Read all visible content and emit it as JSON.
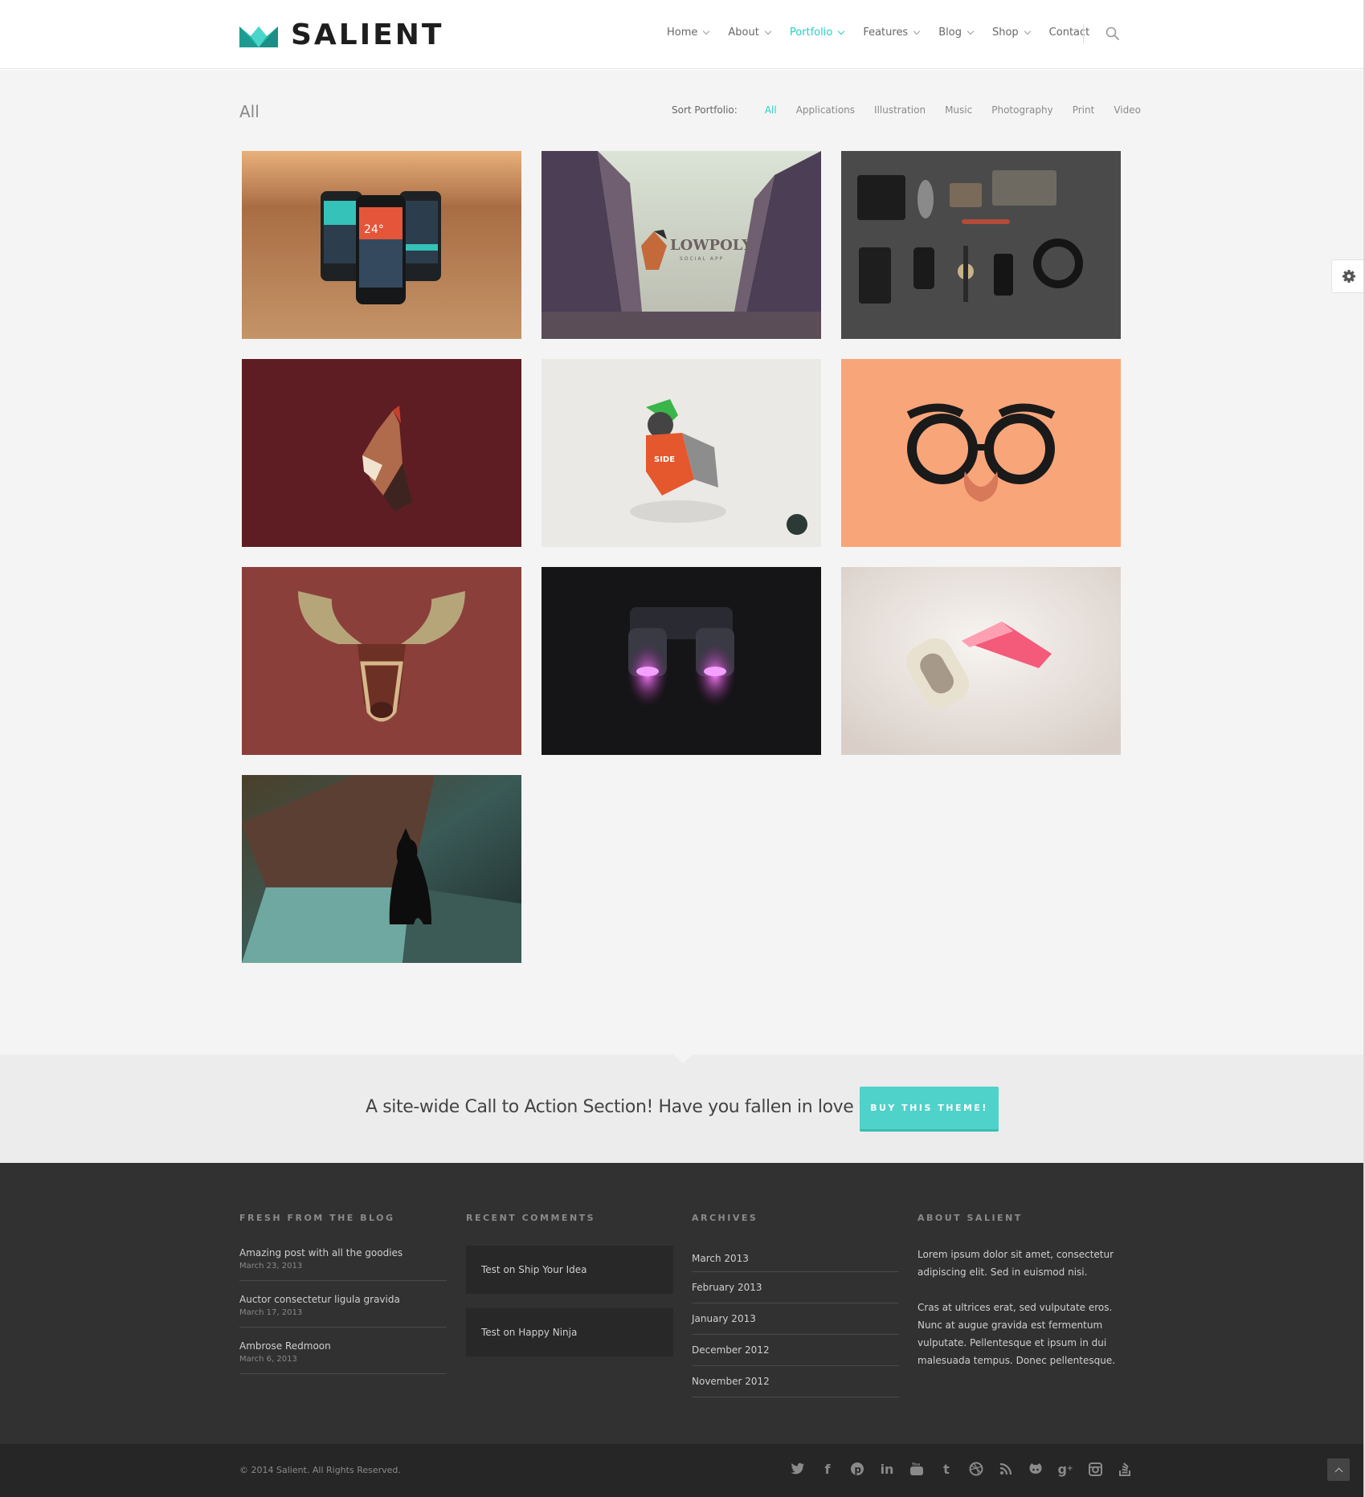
{
  "header": {
    "logo_text": "SALIENT",
    "nav": [
      {
        "label": "Home",
        "dropdown": true,
        "active": false
      },
      {
        "label": "About",
        "dropdown": true,
        "active": false
      },
      {
        "label": "Portfolio",
        "dropdown": true,
        "active": true
      },
      {
        "label": "Features",
        "dropdown": true,
        "active": false
      },
      {
        "label": "Blog",
        "dropdown": true,
        "active": false
      },
      {
        "label": "Shop",
        "dropdown": true,
        "active": false
      },
      {
        "label": "Contact",
        "dropdown": false,
        "active": false
      }
    ],
    "accent_color": "#27cfc3"
  },
  "portfolio": {
    "title": "All",
    "sort_label": "Sort Portfolio:",
    "filters": [
      "All",
      "Applications",
      "Illustration",
      "Music",
      "Photography",
      "Print",
      "Video"
    ],
    "active_filter": "All",
    "items": [
      {
        "name": "phones-app"
      },
      {
        "name": "lowpoly-social-app",
        "caption": "LOWPOLY",
        "subcaption": "SOCIAL APP"
      },
      {
        "name": "flatlay-essentials"
      },
      {
        "name": "profile-illustration"
      },
      {
        "name": "bird-illustration",
        "caption": "SIDE"
      },
      {
        "name": "glasses-mustache"
      },
      {
        "name": "moose-head"
      },
      {
        "name": "binoculars"
      },
      {
        "name": "glasses-3d"
      },
      {
        "name": "black-cat"
      }
    ]
  },
  "cta": {
    "text": "A site-wide Call to Action Section! Have you fallen in love yet?",
    "button": "BUY THIS THEME!"
  },
  "footer": {
    "blog": {
      "heading": "FRESH FROM THE BLOG",
      "posts": [
        {
          "title": "Amazing post with all the goodies",
          "date": "March 23, 2013"
        },
        {
          "title": "Auctor consectetur ligula gravida",
          "date": "March 17, 2013"
        },
        {
          "title": "Ambrose Redmoon",
          "date": "March 6, 2013"
        }
      ]
    },
    "comments": {
      "heading": "RECENT COMMENTS",
      "items": [
        "Test on Ship Your Idea",
        "Test on Happy Ninja"
      ]
    },
    "archives": {
      "heading": "ARCHIVES",
      "items": [
        "March 2013",
        "February 2013",
        "January 2013",
        "December 2012",
        "November 2012"
      ]
    },
    "about": {
      "heading": "ABOUT SALIENT",
      "p1": "Lorem ipsum dolor sit amet, consectetur adipiscing elit. Sed in euismod nisi.",
      "p2": "Cras at ultrices erat, sed vulputate eros. Nunc at augue gravida est fermentum vulputate. Pellentesque et ipsum in dui malesuada tempus. Donec pellentesque."
    },
    "copyright": "© 2014 Salient. All Rights Reserved.",
    "social_icons": [
      "twitter-icon",
      "facebook-icon",
      "pinterest-icon",
      "linkedin-icon",
      "youtube-icon",
      "tumblr-icon",
      "dribbble-icon",
      "rss-icon",
      "github-icon",
      "google-plus-icon",
      "instagram-icon",
      "stackexchange-icon"
    ]
  }
}
